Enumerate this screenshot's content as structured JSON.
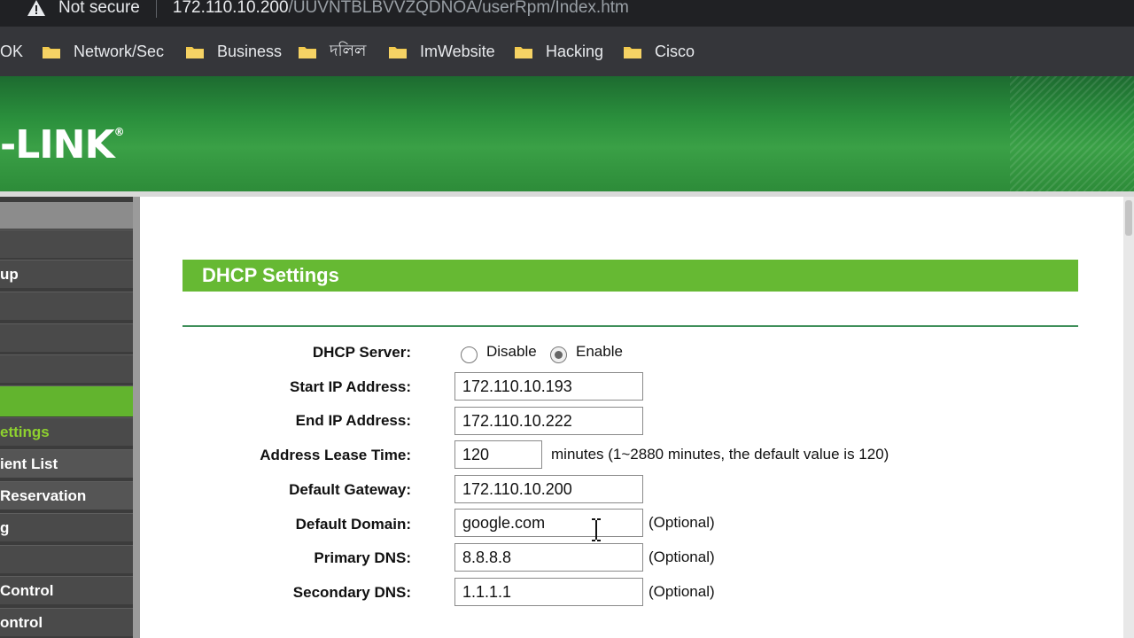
{
  "browser": {
    "security_label": "Not secure",
    "url_host": "172.110.10.200",
    "url_path": "/UUVNTBLBVVZQDNOA/userRpm/Index.htm"
  },
  "bookmarks": [
    {
      "label": "OK"
    },
    {
      "label": "Network/Sec"
    },
    {
      "label": "Business"
    },
    {
      "label": "দলিল"
    },
    {
      "label": "ImWebsite"
    },
    {
      "label": "Hacking"
    },
    {
      "label": "Cisco"
    }
  ],
  "brand": {
    "logo_text": "-LINK",
    "reg_mark": "®"
  },
  "sidebar": {
    "items": [
      {
        "label": ""
      },
      {
        "label": "up"
      },
      {
        "label": ""
      },
      {
        "label": ""
      },
      {
        "label": ""
      },
      {
        "label": ""
      },
      {
        "label": "ettings"
      },
      {
        "label": "ient List"
      },
      {
        "label": " Reservation"
      },
      {
        "label": "g"
      },
      {
        "label": ""
      },
      {
        "label": "Control"
      },
      {
        "label": "ontrol"
      }
    ]
  },
  "section": {
    "title": "DHCP Settings"
  },
  "form": {
    "dhcp_server_label": "DHCP Server:",
    "disable_label": "Disable",
    "enable_label": "Enable",
    "selected_mode": "Enable",
    "start_ip_label": "Start IP Address:",
    "start_ip": "172.110.10.193",
    "end_ip_label": "End IP Address:",
    "end_ip": "172.110.10.222",
    "lease_label": "Address Lease Time:",
    "lease_time": "120",
    "lease_hint": "minutes (1~2880 minutes, the default value is 120)",
    "gateway_label": "Default Gateway:",
    "gateway": "172.110.10.200",
    "domain_label": "Default Domain:",
    "domain": "google.com",
    "primary_dns_label": "Primary DNS:",
    "primary_dns": "8.8.8.8",
    "secondary_dns_label": "Secondary DNS:",
    "secondary_dns": "1.1.1.1",
    "optional_hint": "(Optional)"
  },
  "colors": {
    "header_green": "#2a8f3c",
    "section_green": "#66b933",
    "active_menu_green": "#62b42e",
    "active_text_green": "#8ed12f"
  }
}
